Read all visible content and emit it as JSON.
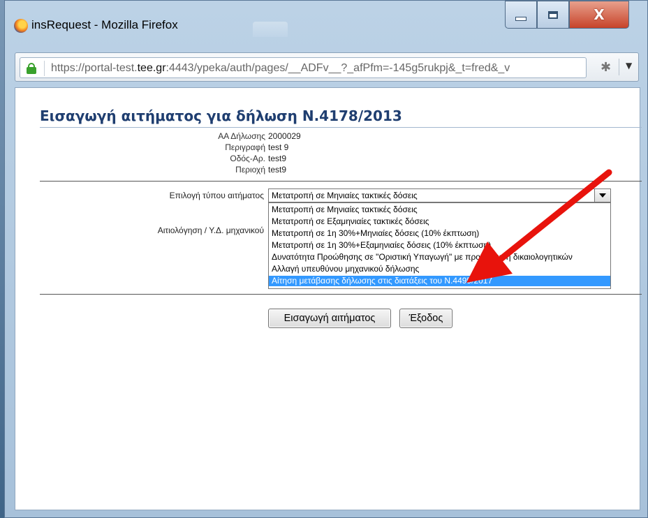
{
  "window": {
    "title": "insRequest - Mozilla Firefox",
    "close_glyph": "X"
  },
  "urlbar": {
    "url_prefix": "https://portal-test.",
    "url_domain": "tee.gr",
    "url_rest": ":4443/ypeka/auth/pages/__ADFv__?_afPfm=-145g5rukpj&_t=fred&_v"
  },
  "page": {
    "title": "Εισαγωγή αιτήματος για δήλωση Ν.4178/2013",
    "info": [
      {
        "label": "ΑΑ Δήλωσης",
        "value": "2000029"
      },
      {
        "label": "Περιγραφή",
        "value": "test 9"
      },
      {
        "label": "Οδός-Αρ.",
        "value": "test9"
      },
      {
        "label": "Περιοχή",
        "value": "test9"
      }
    ],
    "request_type_label": "Επιλογή τύπου αιτήματος",
    "justification_label": "Αιτιολόγηση / Υ.Δ. μηχανικού",
    "select_value": "Μετατροπή σε Μηνιαίες τακτικές δόσεις",
    "options": [
      "Μετατροπή σε Μηνιαίες τακτικές δόσεις",
      "Μετατροπή σε Εξαμηνιαίες τακτικές δόσεις",
      "Μετατροπή σε 1η 30%+Μηνιαίες δόσεις (10% έκπτωση)",
      "Μετατροπή σε 1η 30%+Εξαμηνιαίες δόσεις (10% έκπτωση)",
      "Δυνατότητα Προώθησης σε \"Οριστική Υπαγωγή\" με προσκόμιση δικαιολογητικών",
      "Αλλαγή υπευθύνου μηχανικού δήλωσης",
      "Αίτηση μετάβασης δήλωσης στις διατάξεις του Ν.4495/2017"
    ],
    "selected_option_index": 6,
    "insert_button": "Εισαγωγή αιτήματος",
    "exit_button": "Έξοδος"
  },
  "colors": {
    "title": "#1f3e70",
    "selection": "#3399ff",
    "annotation_arrow": "#e8130c"
  }
}
